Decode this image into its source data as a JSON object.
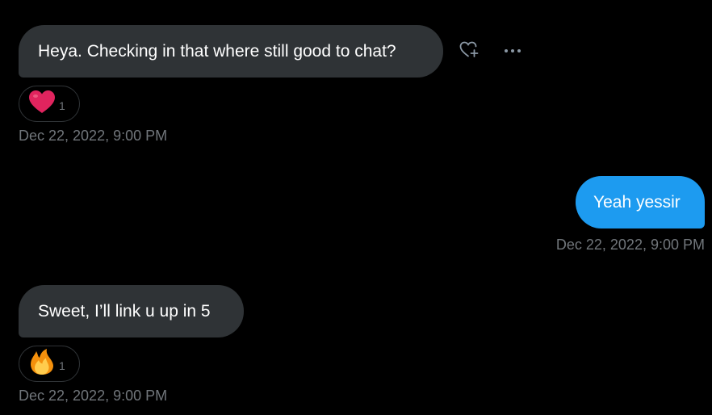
{
  "conversation": {
    "messages": [
      {
        "direction": "received",
        "text": "Heya. Checking in that where still good to chat?",
        "reaction": {
          "icon": "red-heart-icon",
          "count": "1"
        },
        "timestamp": "Dec 22, 2022, 9:00 PM"
      },
      {
        "direction": "sent",
        "text": "Yeah yessir",
        "timestamp": "Dec 22, 2022, 9:00 PM"
      },
      {
        "direction": "received",
        "text": "Sweet, I’ll link u up in 5",
        "reaction": {
          "icon": "fire-icon",
          "count": "1"
        },
        "timestamp": "Dec 22, 2022, 9:00 PM"
      }
    ],
    "hover_actions": [
      {
        "icon": "add-reaction-icon"
      },
      {
        "icon": "more-options-icon"
      }
    ]
  },
  "colors": {
    "background": "#000000",
    "received_bubble": "#2f3336",
    "sent_bubble": "#1d9bf0",
    "secondary_text": "#71767b",
    "heart": "#e0245e"
  }
}
